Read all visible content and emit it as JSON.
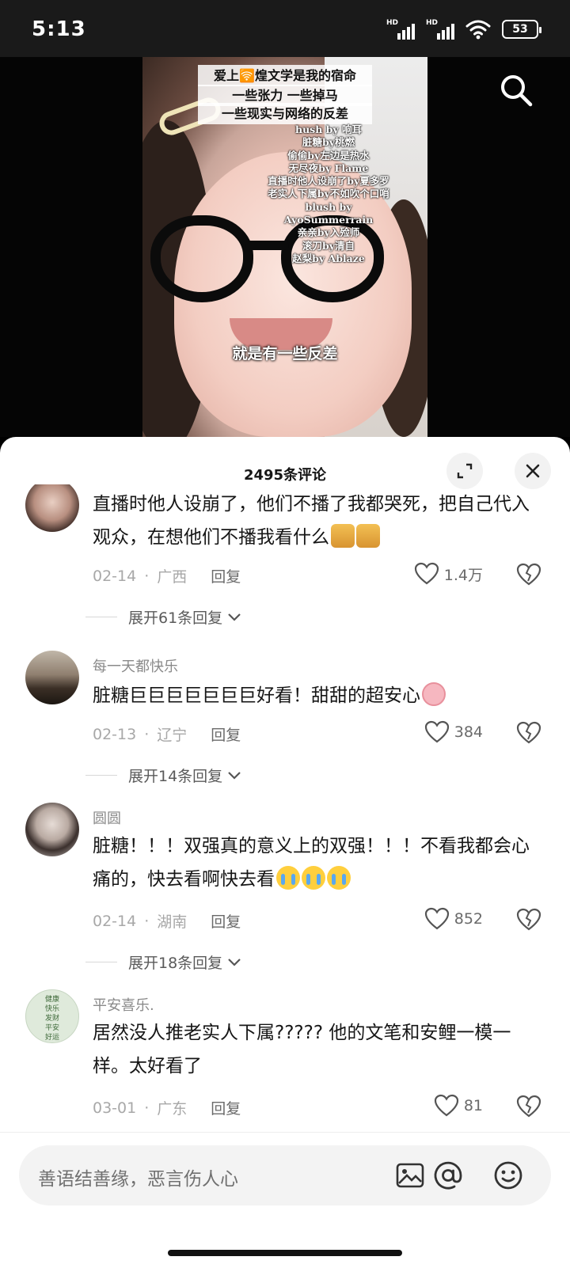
{
  "status_bar": {
    "time": "5:13",
    "sim1_tag": "HD",
    "sim2_tag": "HD",
    "battery": "53"
  },
  "video": {
    "title_lines": [
      "爱上🛜煌文学是我的宿命",
      "一些张力 一些掉马",
      "一些现实与网络的反差"
    ],
    "book_list": [
      "hush by 响耳",
      "脏糖by桃燃",
      "偷偷by左边是热水",
      "无尽夜by Flame",
      "直播时他人设崩了by夏多罗",
      "老实人下属by不如吹个口哨",
      "blush by AyoSummerrain",
      "亲亲by入殓师",
      "滚刀by清自",
      "赵梨by Ablaze"
    ],
    "subtitle": "就是有一些反差"
  },
  "comments_panel": {
    "title": "2495条评论",
    "comments": [
      {
        "username": "",
        "text": "直播时他人设崩了，他们不播了我都哭死，把自己代入观众，在想他们不播我看什么",
        "emojis": [
          "cat-emoji",
          "cat-emoji"
        ],
        "date": "02-14",
        "location": "广西",
        "reply_label": "回复",
        "likes": "1.4万",
        "expand_label": "展开61条回复"
      },
      {
        "username": "每一天都快乐",
        "text": "脏糖巨巨巨巨巨巨巨好看！甜甜的超安心",
        "emojis": [
          "pig-emoji"
        ],
        "date": "02-13",
        "location": "辽宁",
        "reply_label": "回复",
        "likes": "384",
        "expand_label": "展开14条回复"
      },
      {
        "username": "圆圆",
        "text": "脏糖！！！双强真的意义上的双强！！！不看我都会心痛的，快去看啊快去看",
        "emojis": [
          "crying-emoji",
          "crying-emoji",
          "crying-emoji"
        ],
        "date": "02-14",
        "location": "湖南",
        "reply_label": "回复",
        "likes": "852",
        "expand_label": "展开18条回复"
      },
      {
        "username": "平安喜乐.",
        "text": "居然没人推老实人下属????? 他的文笔和安鲤一模一样。太好看了",
        "emojis": [],
        "date": "03-01",
        "location": "广东",
        "reply_label": "回复",
        "likes": "81",
        "expand_label": ""
      }
    ],
    "avatar4_text": [
      "健康",
      "快乐",
      "发财",
      "平安",
      "好运"
    ]
  },
  "input": {
    "placeholder": "善语结善缘，恶言伤人心"
  },
  "colors": {
    "text": "#161616",
    "muted": "#a8a8a8",
    "panel_bg": "#ffffff",
    "chip_bg": "#f2f2f2"
  }
}
